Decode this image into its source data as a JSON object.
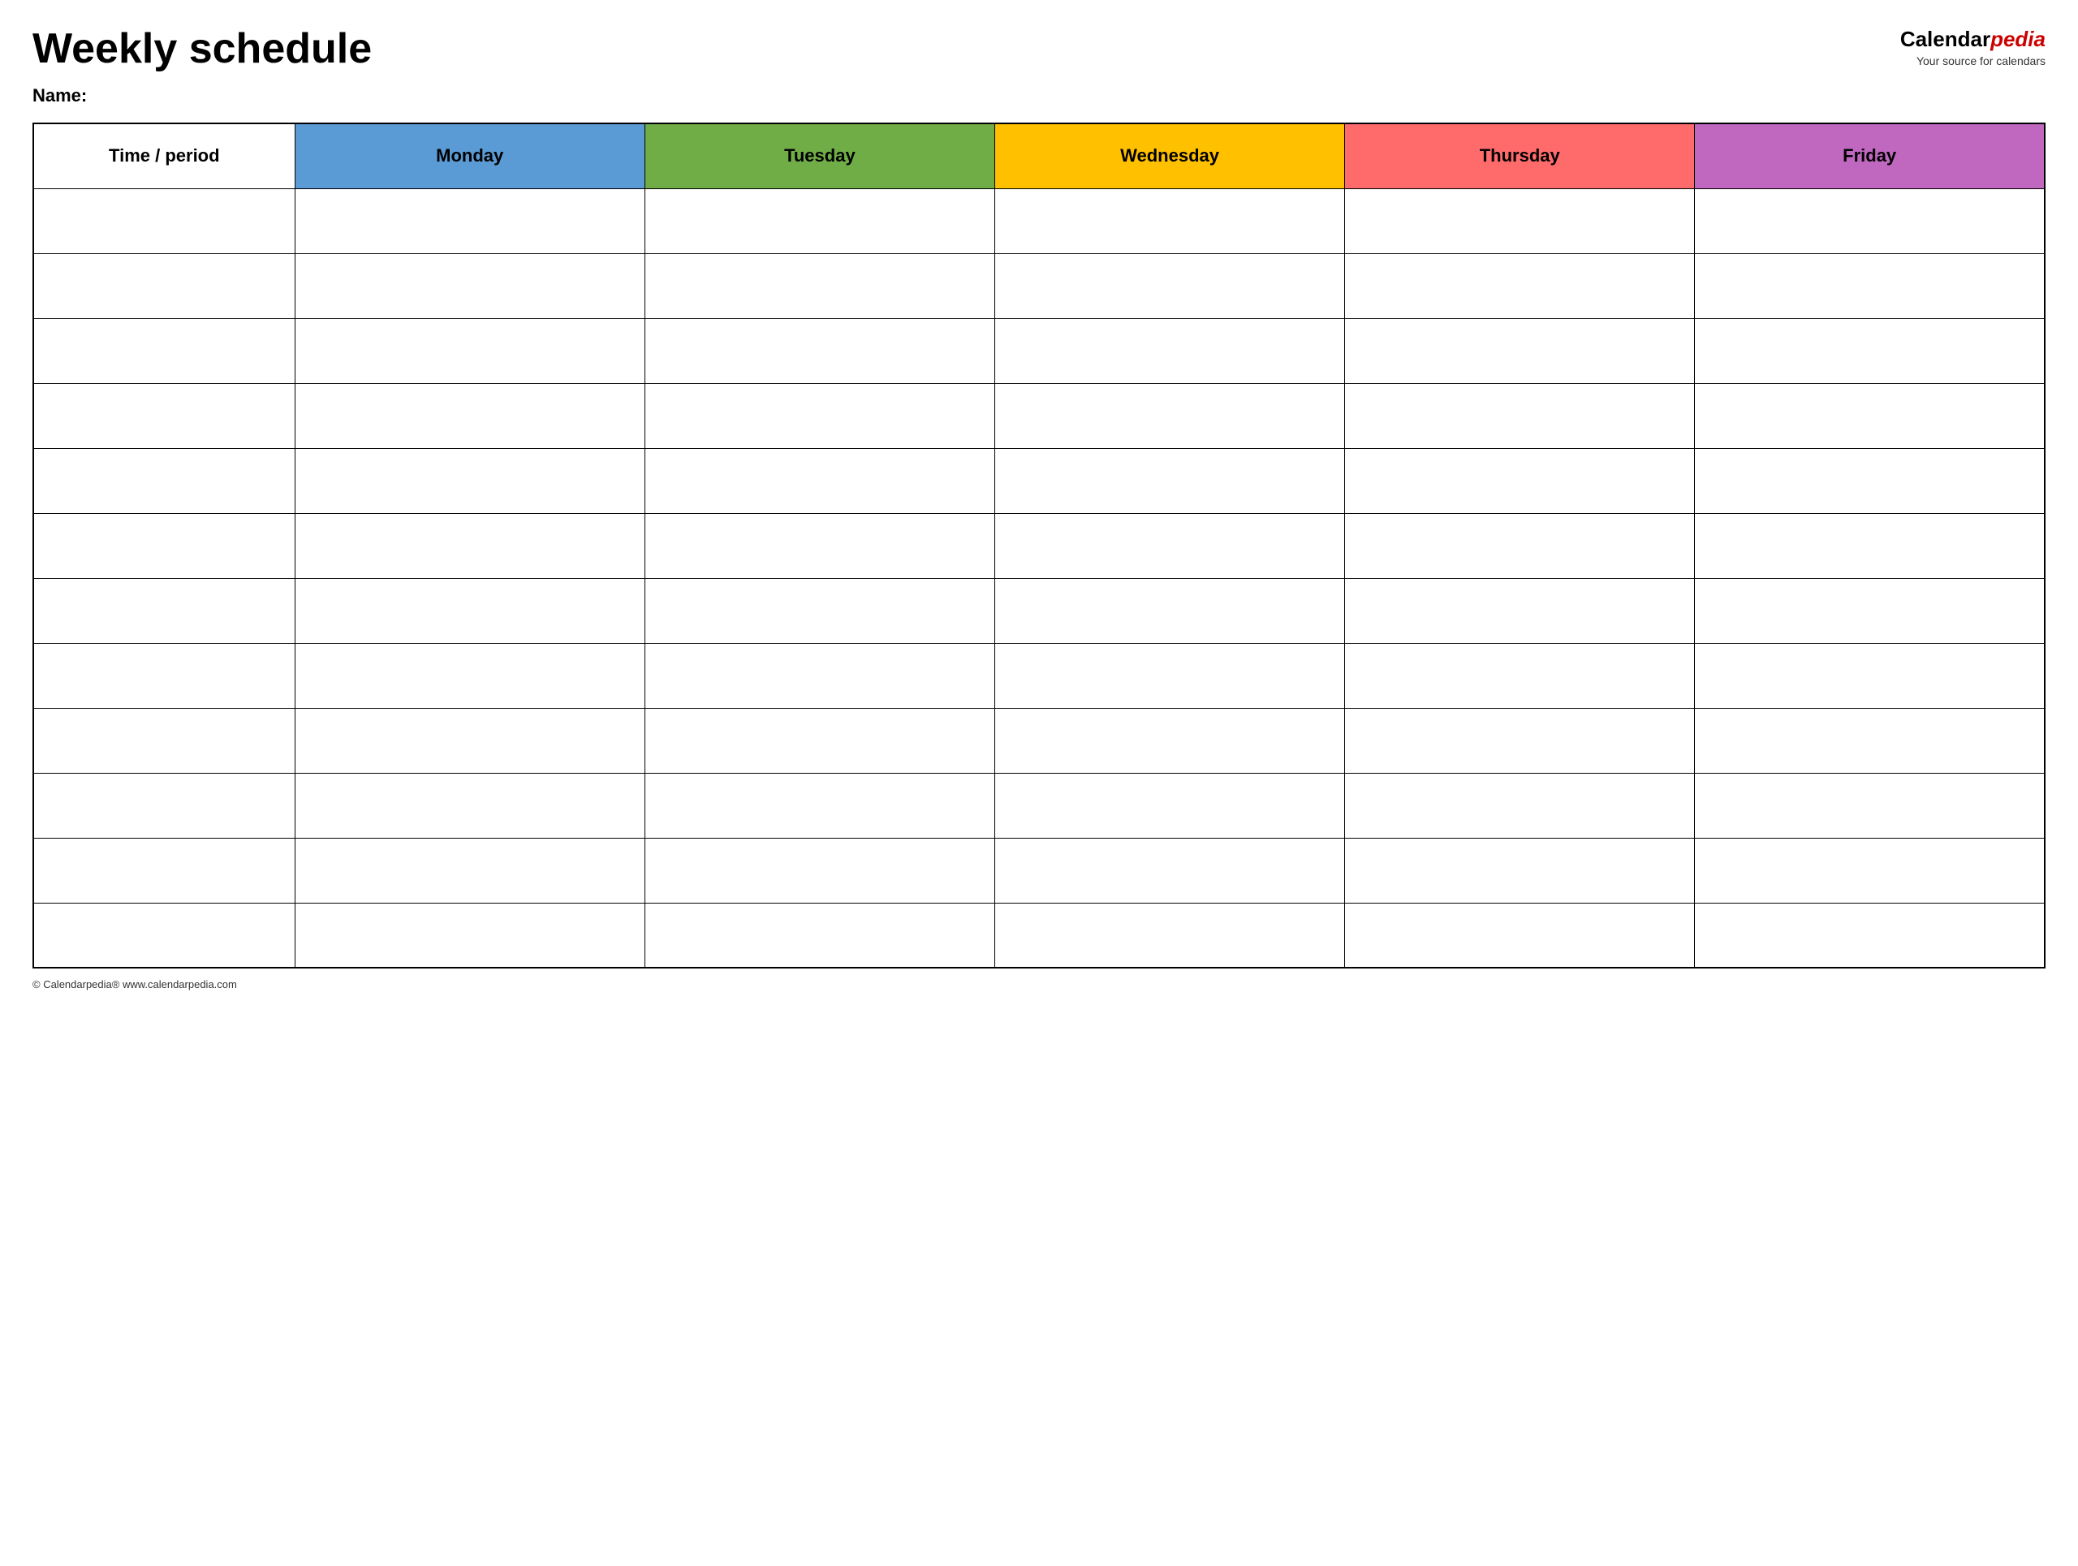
{
  "header": {
    "title": "Weekly schedule",
    "brand_calendar": "Calendar",
    "brand_pedia": "pedia",
    "brand_tagline": "Your source for calendars"
  },
  "name_label": "Name:",
  "table": {
    "columns": [
      {
        "id": "time",
        "label": "Time / period",
        "color": "#ffffff"
      },
      {
        "id": "monday",
        "label": "Monday",
        "color": "#5b9bd5"
      },
      {
        "id": "tuesday",
        "label": "Tuesday",
        "color": "#70ad47"
      },
      {
        "id": "wednesday",
        "label": "Wednesday",
        "color": "#ffc000"
      },
      {
        "id": "thursday",
        "label": "Thursday",
        "color": "#ff6b6b"
      },
      {
        "id": "friday",
        "label": "Friday",
        "color": "#c067c0"
      }
    ],
    "row_count": 12
  },
  "footer": {
    "text": "© Calendarpedia®  www.calendarpedia.com"
  }
}
